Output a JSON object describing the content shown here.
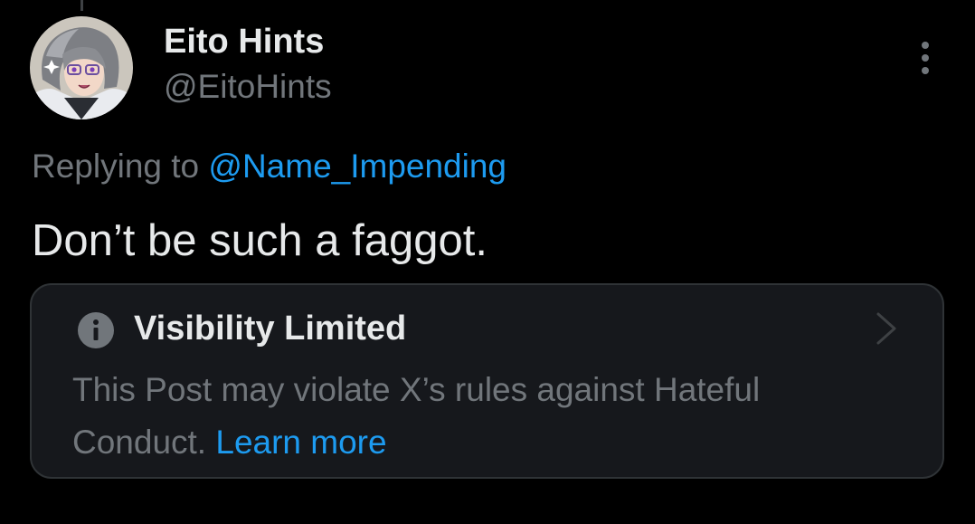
{
  "post": {
    "author": {
      "display_name": "Eito Hints",
      "handle": "@EitoHints",
      "avatar": "avatar-illustration"
    },
    "more_icon": "more-vertical-icon",
    "reply_context": {
      "prefix": "Replying to ",
      "mention": "@Name_Impending"
    },
    "text": "Don’t be such a faggot."
  },
  "notice": {
    "icon": "info-icon",
    "title": "Visibility Limited",
    "body": "This Post may violate X’s rules against Hateful Conduct. ",
    "link_label": "Learn more",
    "chevron_icon": "chevron-right-icon"
  },
  "colors": {
    "background": "#000000",
    "primary_text": "#e7e9ea",
    "secondary_text": "#71767b",
    "link": "#1d9bf0",
    "notice_background": "#16181c",
    "notice_border": "#2f3336"
  }
}
